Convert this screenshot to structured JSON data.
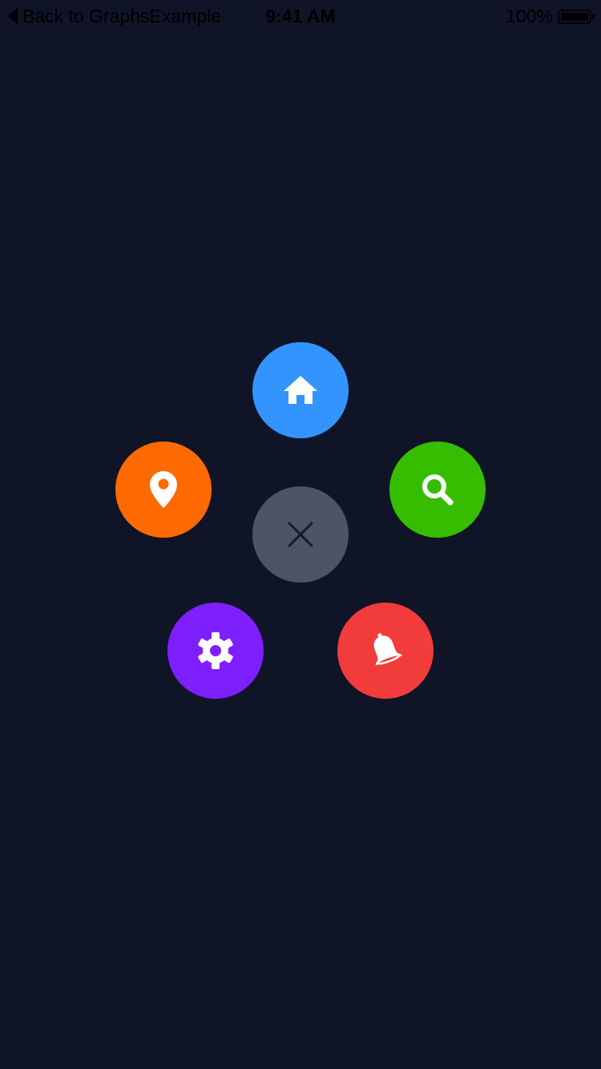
{
  "status_bar": {
    "back_label": "Back to GraphsExample",
    "time": "9:41 AM",
    "battery": "100%"
  },
  "colors": {
    "background": "#0f1427",
    "home": "#3394ff",
    "location": "#ff6a00",
    "search": "#37bd00",
    "close": "#4f5464",
    "settings": "#7e1fff",
    "notifications": "#f23b3b"
  },
  "menu": [
    {
      "id": "home",
      "icon": "home-icon"
    },
    {
      "id": "location",
      "icon": "location-pin-icon"
    },
    {
      "id": "search",
      "icon": "search-icon"
    },
    {
      "id": "close",
      "icon": "close-icon"
    },
    {
      "id": "settings",
      "icon": "gear-icon"
    },
    {
      "id": "notifications",
      "icon": "bell-icon"
    }
  ]
}
